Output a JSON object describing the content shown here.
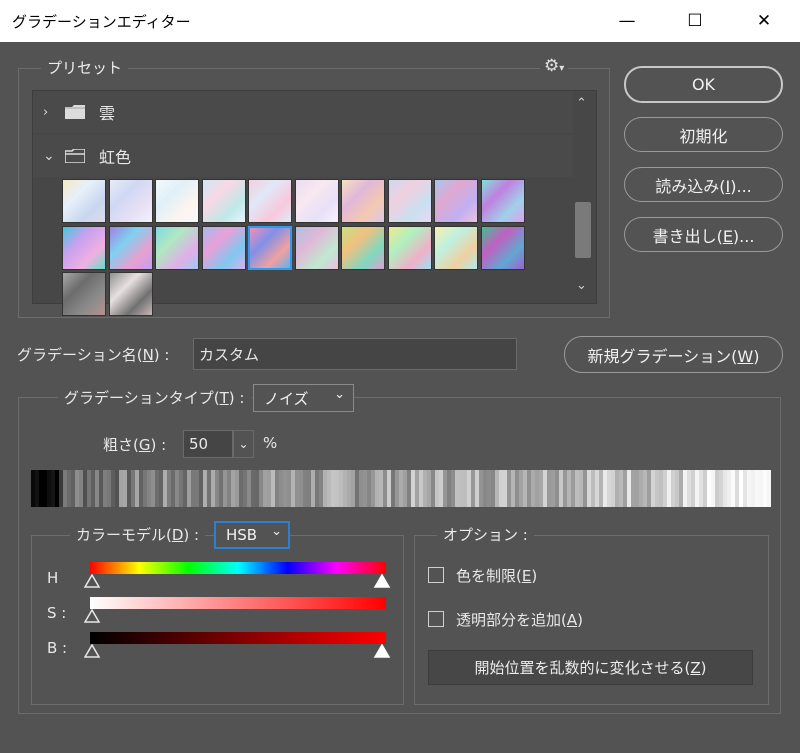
{
  "window": {
    "title": "グラデーションエディター",
    "minimize_glyph": "—",
    "maximize_glyph": "☐",
    "close_glyph": "✕"
  },
  "presets": {
    "group_label": "プリセット",
    "gear_glyph": "⚙",
    "gear_caret": "▾",
    "folders": [
      {
        "label": "雲",
        "chevron": "›",
        "expanded": false
      },
      {
        "label": "虹色",
        "chevron": "⌄",
        "expanded": true
      }
    ],
    "scroll_up": "⌃",
    "scroll_down": "⌄",
    "swatches": [
      [
        "#f7e9c4",
        "#e6f0fa",
        "#c9d6f0",
        "#dcdce8"
      ],
      [
        "#e8ecf8",
        "#d0d8f4",
        "#e8e0f4",
        "#f0f4fc"
      ],
      [
        "#f4f8fc",
        "#e0f0f8",
        "#fcf4f0",
        "#f8f8fc"
      ],
      [
        "#cfe8f8",
        "#f8d8e4",
        "#bfe8e8",
        "#e8f4fc"
      ],
      [
        "#f4d0dc",
        "#e0e8f8",
        "#f8c8dc",
        "#dcecf8"
      ],
      [
        "#eadcf0",
        "#f8e8f0",
        "#e8e0f8",
        "#f8f4fc"
      ],
      [
        "#f8e0c0",
        "#e0b8d8",
        "#f4c8b0",
        "#d8c8f0"
      ],
      [
        "#d0d8f0",
        "#f0d0e0",
        "#c8e0f0",
        "#e8d8f4"
      ],
      [
        "#a8c4f0",
        "#e0a8d0",
        "#c0b0f0",
        "#f0c0e0"
      ],
      [
        "#80e0d8",
        "#c080e0",
        "#a0d0e8",
        "#e0a0f0"
      ],
      [
        "#40c8d8",
        "#c8a0f0",
        "#f0b0e0",
        "#60e0c8"
      ],
      [
        "#a080e0",
        "#80d0f0",
        "#e8a0d0",
        "#c0a0f0"
      ],
      [
        "#80d8e0",
        "#b0e8c0",
        "#e0b0e8",
        "#a0c8f0"
      ],
      [
        "#a8b8f0",
        "#e8a0d8",
        "#80c8f0",
        "#d8b0f0"
      ],
      [
        "#f090b8",
        "#8090e8",
        "#f0a0a0",
        "#60b0f0"
      ],
      [
        "#b0c0e0",
        "#e0b8d8",
        "#c0e8d0",
        "#e8c0e0"
      ],
      [
        "#c8e080",
        "#f0c080",
        "#80d8c0",
        "#e0a0d0"
      ],
      [
        "#f0e890",
        "#b0f0c0",
        "#f0b0c8",
        "#a0e0f0"
      ],
      [
        "#f8f0b0",
        "#c0f0e0",
        "#f0d0a0",
        "#b0e8f0"
      ],
      [
        "#40c090",
        "#c060c0",
        "#60a8d0",
        "#a060d0"
      ],
      [
        "#a8a8a8",
        "#6c6c6c",
        "#8c8c8c",
        "#b89090"
      ],
      [
        "#909090",
        "#e8e0e0",
        "#707070",
        "#c8b8b8"
      ]
    ],
    "selected_index": 14
  },
  "buttons": {
    "ok": "OK",
    "reset": "初期化",
    "load_pre": "読み込み(",
    "load_key": "I",
    "load_post": ")...",
    "save_pre": "書き出し(",
    "save_key": "E",
    "save_post": ")...",
    "new_pre": "新規グラデーション(",
    "new_key": "W",
    "new_post": ")"
  },
  "name_field": {
    "label_pre": "グラデーション名(",
    "label_key": "N",
    "label_post": ") :",
    "value": "カスタム"
  },
  "type_field": {
    "label_pre": "グラデーションタイプ(",
    "label_key": "T",
    "label_post": ") :",
    "value": "ノイズ",
    "caret": "⌄"
  },
  "roughness": {
    "label_pre": "粗さ(",
    "label_key": "G",
    "label_post": ") :",
    "value": "50",
    "caret": "⌄",
    "unit": "%"
  },
  "color_model": {
    "label_pre": "カラーモデル(",
    "label_key": "D",
    "label_post": ") :",
    "value": "HSB",
    "caret": "⌄",
    "channels": [
      {
        "label": "H",
        "left_stop": 0.0,
        "right_stop": 1.0
      },
      {
        "label": "S :",
        "left_stop": 0.0,
        "right_stop": 1.0
      },
      {
        "label": "B :",
        "left_stop": 0.0,
        "right_stop": 1.0
      }
    ]
  },
  "options": {
    "group_label": "オプション :",
    "restrict_pre": "色を制限(",
    "restrict_key": "E",
    "restrict_post": ")",
    "restrict_checked": false,
    "transparency_pre": "透明部分を追加(",
    "transparency_key": "A",
    "transparency_post": ")",
    "transparency_checked": false,
    "randomize_pre": "開始位置を乱数的に変化させる(",
    "randomize_key": "Z",
    "randomize_post": ")"
  }
}
